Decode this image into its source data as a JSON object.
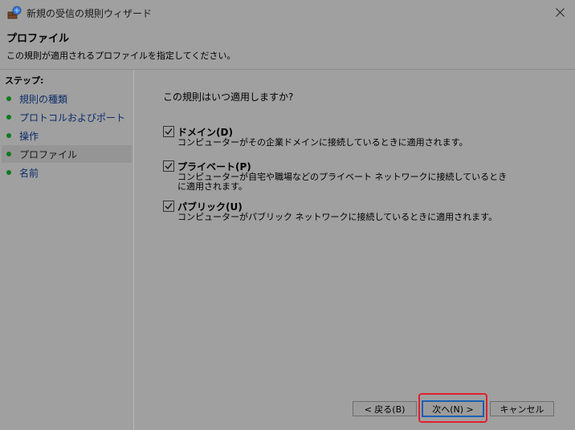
{
  "window": {
    "title": "新規の受信の規則ウィザード"
  },
  "header": {
    "title": "プロファイル",
    "subtitle": "この規則が適用されるプロファイルを指定してください。"
  },
  "sidebar": {
    "steps_label": "ステップ:",
    "items": [
      {
        "label": "規則の種類"
      },
      {
        "label": "プロトコルおよびポート"
      },
      {
        "label": "操作"
      },
      {
        "label": "プロファイル",
        "selected": true
      },
      {
        "label": "名前"
      }
    ]
  },
  "main": {
    "question": "この規則はいつ適用しますか?",
    "options": [
      {
        "label": "ドメイン(D)",
        "checked": true,
        "description": "コンピューターがその企業ドメインに接続しているときに適用されます。"
      },
      {
        "label": "プライベート(P)",
        "checked": true,
        "description": "コンピューターが自宅や職場などのプライベート ネットワークに接続しているときに適用されます。"
      },
      {
        "label": "パブリック(U)",
        "checked": true,
        "description": "コンピューターがパブリック ネットワークに接続しているときに適用されます。"
      }
    ]
  },
  "buttons": {
    "back": "< 戻る(B)",
    "next": "次へ(N) >",
    "cancel": "キャンセル"
  },
  "colors": {
    "highlight_border": "#e0202b",
    "step_bullet": "#0e7a1f",
    "link": "#0d2d6b"
  }
}
